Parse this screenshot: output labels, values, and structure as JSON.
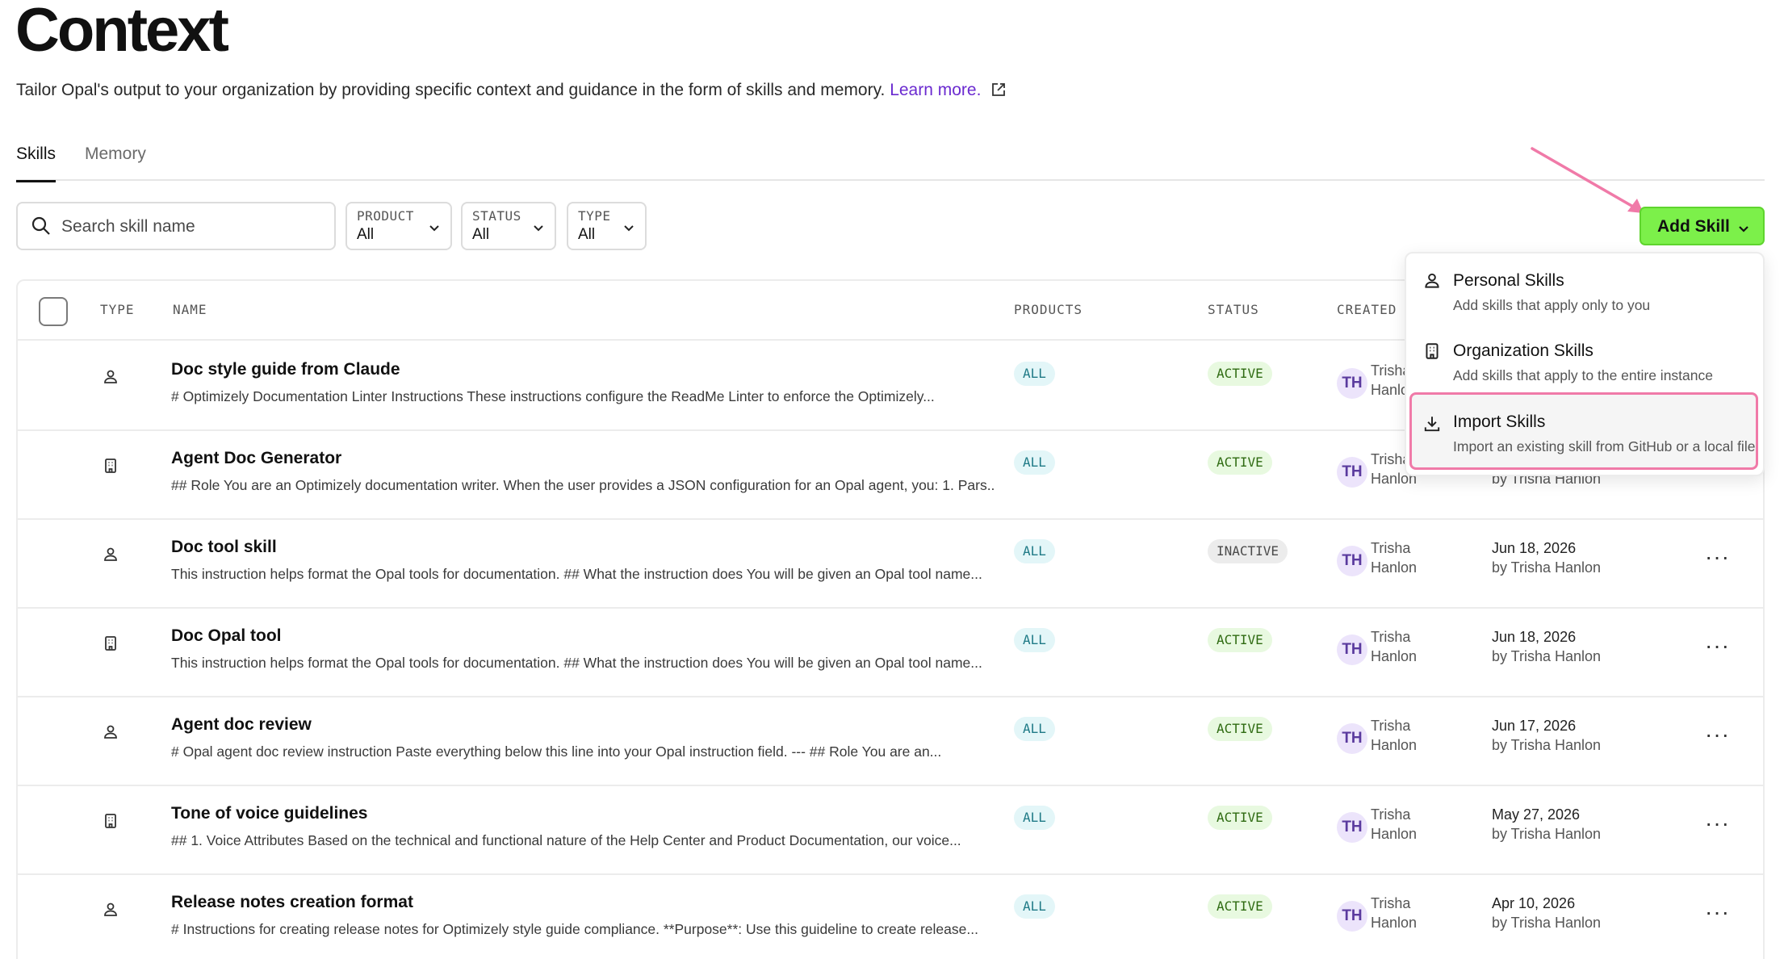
{
  "header": {
    "title": "Context",
    "subtitle": "Tailor Opal's output to your organization by providing specific context and guidance in the form of skills and memory.",
    "learn_more": "Learn more."
  },
  "tabs": [
    {
      "label": "Skills",
      "active": true
    },
    {
      "label": "Memory",
      "active": false
    }
  ],
  "filters": {
    "search_placeholder": "Search skill name",
    "product": {
      "label": "PRODUCT",
      "value": "All"
    },
    "status": {
      "label": "STATUS",
      "value": "All"
    },
    "type": {
      "label": "TYPE",
      "value": "All"
    }
  },
  "add_skill": {
    "label": "Add Skill"
  },
  "table": {
    "columns": {
      "type": "TYPE",
      "name": "NAME",
      "products": "PRODUCTS",
      "status": "STATUS",
      "created": "CREATED"
    },
    "rows": [
      {
        "type_icon": "person-icon",
        "name": "Doc style guide from Claude",
        "desc": "# Optimizely Documentation Linter Instructions These instructions configure the ReadMe Linter to enforce the Optimizely...",
        "product": "ALL",
        "status": "ACTIVE",
        "initials": "TH",
        "creator_first": "Trisha",
        "creator_last": "Hanlon",
        "date": "",
        "by": ""
      },
      {
        "type_icon": "building-icon",
        "name": "Agent Doc Generator",
        "desc": "## Role You are an Optimizely documentation writer. When the user provides a JSON configuration for an Opal agent, you: 1. Pars...",
        "product": "ALL",
        "status": "ACTIVE",
        "initials": "TH",
        "creator_first": "Trisha",
        "creator_last": "Hanlon",
        "date": "",
        "by": "by Trisha Hanlon"
      },
      {
        "type_icon": "person-icon",
        "name": "Doc tool skill",
        "desc": "This instruction helps format the Opal tools for documentation. ## What the instruction does You will be given an Opal tool name...",
        "product": "ALL",
        "status": "INACTIVE",
        "initials": "TH",
        "creator_first": "Trisha",
        "creator_last": "Hanlon",
        "date": "Jun 18, 2026",
        "by": "by Trisha Hanlon"
      },
      {
        "type_icon": "building-icon",
        "name": "Doc Opal tool",
        "desc": "This instruction helps format the Opal tools for documentation. ## What the instruction does You will be given an Opal tool name...",
        "product": "ALL",
        "status": "ACTIVE",
        "initials": "TH",
        "creator_first": "Trisha",
        "creator_last": "Hanlon",
        "date": "Jun 18, 2026",
        "by": "by Trisha Hanlon"
      },
      {
        "type_icon": "person-icon",
        "name": "Agent doc review",
        "desc": "# Opal agent doc review instruction Paste everything below this line into your Opal instruction field. --- ## Role You are an...",
        "product": "ALL",
        "status": "ACTIVE",
        "initials": "TH",
        "creator_first": "Trisha",
        "creator_last": "Hanlon",
        "date": "Jun 17, 2026",
        "by": "by Trisha Hanlon"
      },
      {
        "type_icon": "building-icon",
        "name": "Tone of voice guidelines",
        "desc": "## 1. Voice Attributes Based on the technical and functional nature of the Help Center and Product Documentation, our voice...",
        "product": "ALL",
        "status": "ACTIVE",
        "initials": "TH",
        "creator_first": "Trisha",
        "creator_last": "Hanlon",
        "date": "May 27, 2026",
        "by": "by Trisha Hanlon"
      },
      {
        "type_icon": "person-icon",
        "name": "Release notes creation format",
        "desc": "# Instructions for creating release notes for Optimizely style guide compliance. **Purpose**: Use this guideline to create release...",
        "product": "ALL",
        "status": "ACTIVE",
        "initials": "TH",
        "creator_first": "Trisha",
        "creator_last": "Hanlon",
        "date": "Apr 10, 2026",
        "by": "by Trisha Hanlon"
      }
    ]
  },
  "dropdown": {
    "items": [
      {
        "icon": "person-icon",
        "title": "Personal Skills",
        "desc": "Add skills that apply only to you"
      },
      {
        "icon": "building-icon",
        "title": "Organization Skills",
        "desc": "Add skills that apply to the entire instance"
      },
      {
        "icon": "download-icon",
        "title": "Import Skills",
        "desc": "Import an existing skill from GitHub or a local file"
      }
    ]
  },
  "colors": {
    "accent_green": "#7cf04a",
    "link_purple": "#6b2bd0",
    "highlight_pink": "#f07aa8",
    "annotation_arrow": "#f07aa8"
  }
}
